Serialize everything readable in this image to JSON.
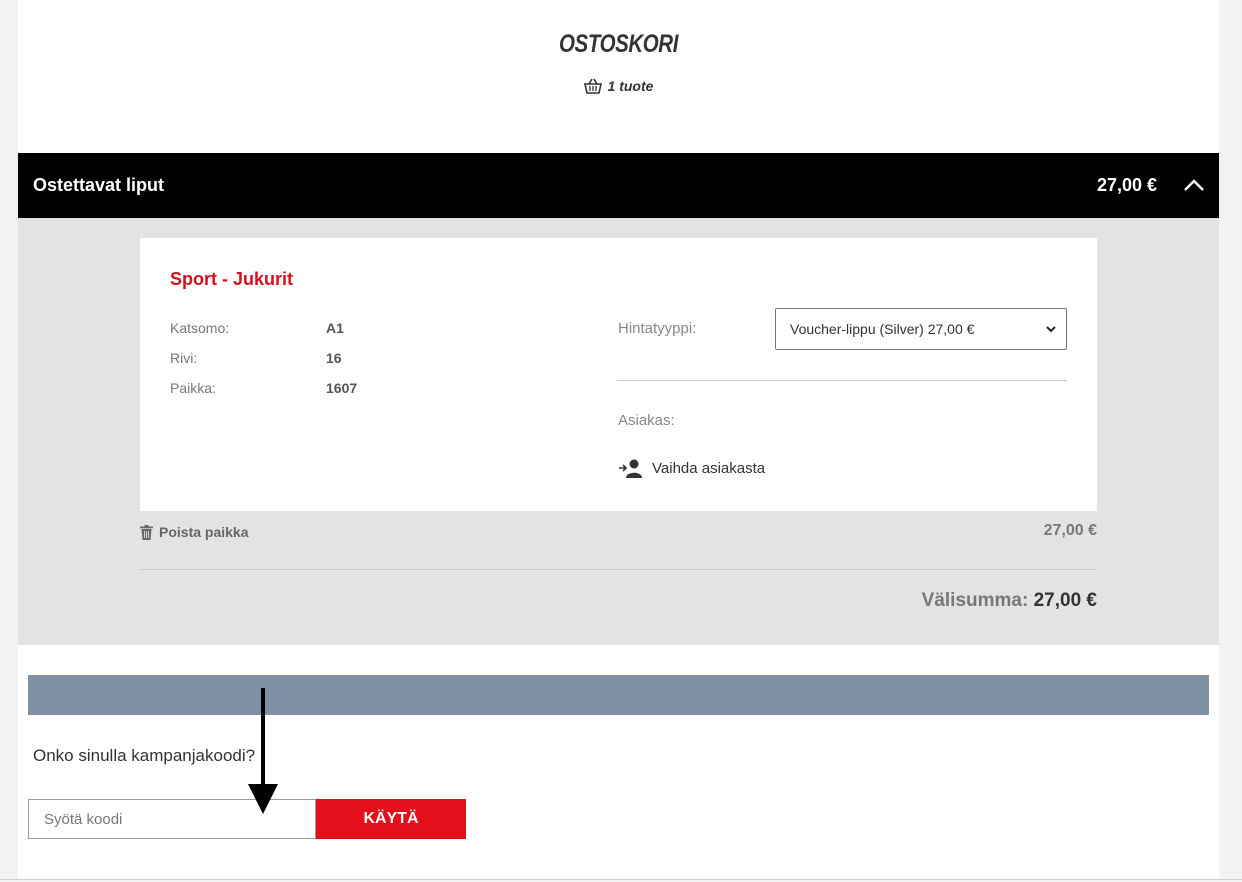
{
  "cart": {
    "title": "OSTOSKORI",
    "item_count": "1 tuote",
    "icon": "basket-icon"
  },
  "tickets_section": {
    "title": "Ostettavat liput",
    "total": "27,00 €",
    "collapse_icon": "chevron-up-icon"
  },
  "ticket": {
    "event_name": "Sport - Jukurit",
    "fields": [
      {
        "label": "Katsomo:",
        "value": "A1"
      },
      {
        "label": "Rivi:",
        "value": "16"
      },
      {
        "label": "Paikka:",
        "value": "1607"
      }
    ],
    "price_type_label": "Hintatyyppi:",
    "price_type_selected": "Voucher-lippu (Silver) 27,00 €",
    "customer_label": "Asiakas:",
    "change_customer_label": "Vaihda asiakasta",
    "remove_seat_label": "Poista paikka",
    "seat_price": "27,00 €"
  },
  "subtotal": {
    "label": "Välisumma:",
    "amount": "27,00 €"
  },
  "promo": {
    "question": "Onko sinulla kampanjakoodi?",
    "input_placeholder": "Syötä koodi",
    "apply_label": "KÄYTÄ"
  },
  "colors": {
    "accent_red": "#d4101a",
    "button_red": "#e3101b",
    "header_black": "#000000",
    "promo_bar": "#8090a3",
    "panel_gray": "#e3e3e3"
  }
}
